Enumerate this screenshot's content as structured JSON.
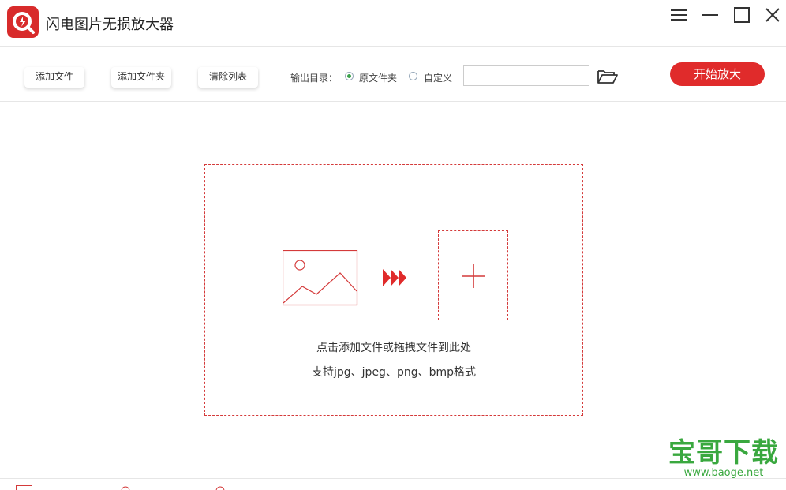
{
  "app": {
    "title": "闪电图片无损放大器"
  },
  "toolbar": {
    "add_file": "添加文件",
    "add_folder": "添加文件夹",
    "clear_list": "清除列表",
    "output_dir_label": "输出目录：",
    "radio_original": "原文件夹",
    "radio_custom": "自定义",
    "selected_output": "原文件夹",
    "path_value": "",
    "start_button": "开始放大"
  },
  "dropzone": {
    "hint_line1": "点击添加文件或拖拽文件到此处",
    "hint_line2": "支持jpg、jpeg、png、bmp格式"
  },
  "watermark": {
    "text": "宝哥下载",
    "url": "www.baoge.net"
  },
  "icons": [
    "app-logo",
    "menu-icon",
    "minimize-icon",
    "maximize-icon",
    "close-icon",
    "folder-open-icon",
    "image-placeholder-icon",
    "triple-arrow-icon",
    "plus-icon"
  ],
  "colors": {
    "accent": "#e02b2b",
    "dashed_border": "#d43a3a",
    "radio_checked": "#3aa24a",
    "watermark": "#3aa83f"
  }
}
